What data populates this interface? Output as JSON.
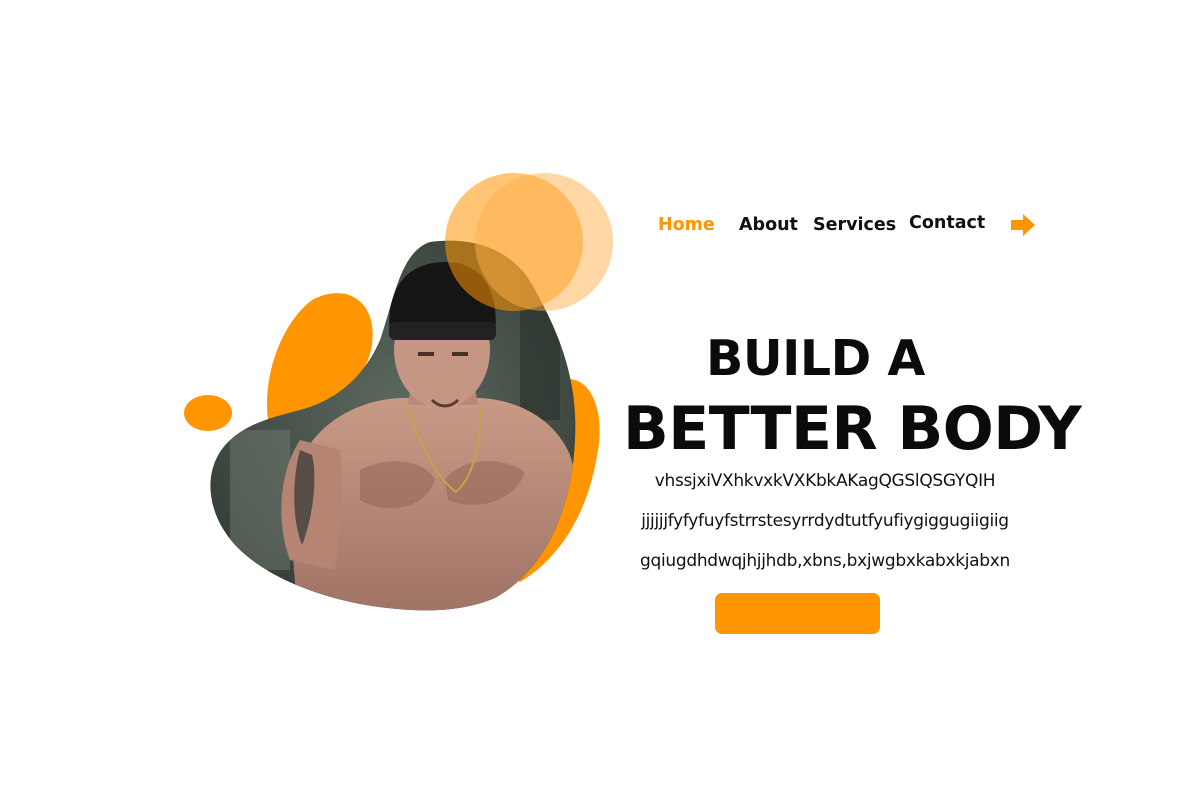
{
  "theme": {
    "accent": "#FF9501",
    "accent_light": "#FFC36A",
    "text": "#111111"
  },
  "nav": {
    "items": [
      {
        "label": "Home",
        "active": true
      },
      {
        "label": "About",
        "active": false
      },
      {
        "label": "Services",
        "active": false
      },
      {
        "label": "Contact",
        "active": false
      }
    ],
    "arrow_icon": "arrow-right-icon"
  },
  "hero": {
    "headline_line1": "BUILD A",
    "headline_line2": "BETTER BODY",
    "body_lines": [
      "vhssjxiVXhkvxkVXKbkAKagQGSlQSGYQIH",
      "jjjjjjfyfyfuyfstrrstesyrrdydtutfyufiygiggugiigiig",
      "gqiugdhdwqjhjjhdb,xbns,bxjwgbxkabxkjabxn"
    ],
    "cta_label": "",
    "image_subject": "bodybuilder-photo"
  }
}
